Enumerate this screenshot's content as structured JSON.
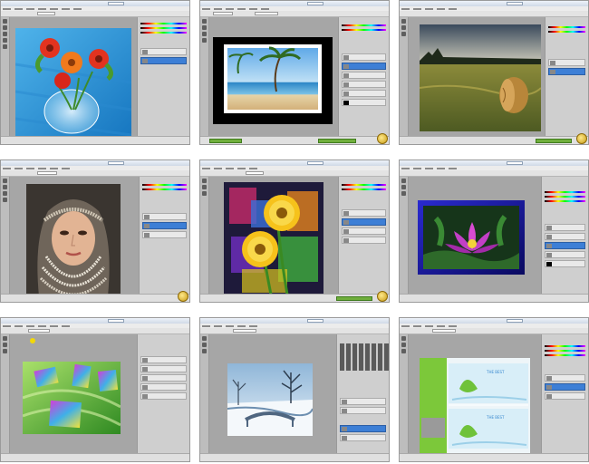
{
  "screens": [
    {
      "name": "flowers-in-fishbowl",
      "accent": "#1e8fd8"
    },
    {
      "name": "beach-stamp-frame",
      "accent": "#2e7fd0"
    },
    {
      "name": "hay-bale-field",
      "accent": "#5b8c3a"
    },
    {
      "name": "woman-with-pearls",
      "accent": "#7a6a5a"
    },
    {
      "name": "yellow-daisies",
      "accent": "#f6c21b"
    },
    {
      "name": "purple-lotus",
      "accent": "#c23fc6"
    },
    {
      "name": "green-leaves-collage",
      "accent": "#7fd34a"
    },
    {
      "name": "snowy-bridge",
      "accent": "#8fb6d8"
    },
    {
      "name": "web-banner-layout",
      "accent": "#7cc83a"
    }
  ],
  "banner": {
    "title": "THE BEST",
    "title2": "THE BEST"
  },
  "colors": {
    "workspace": "#a6a6a6",
    "panel": "#cfcfcf",
    "selected_layer": "#3d7fd6",
    "taskbar": "#6fae3c"
  }
}
